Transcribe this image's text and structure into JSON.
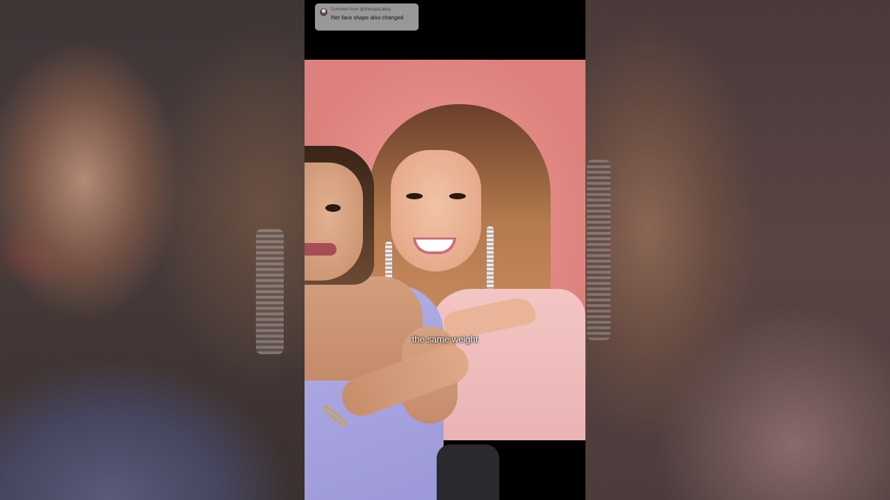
{
  "comment": {
    "from": "Comment from @MakaylaLaboy",
    "text": "Her face shape also changed",
    "avatar_icon": "avatar-icon"
  },
  "caption": "the same weight"
}
